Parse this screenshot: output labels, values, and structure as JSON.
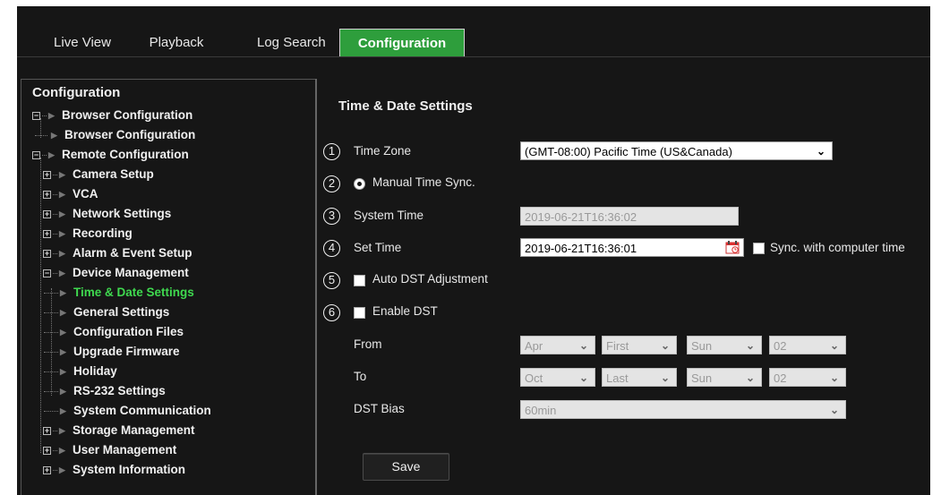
{
  "tabs": [
    {
      "label": "Live View"
    },
    {
      "label": "Playback"
    },
    {
      "label": "Log Search"
    },
    {
      "label": "Configuration"
    }
  ],
  "tree": {
    "title": "Configuration",
    "nodes": [
      {
        "label": "Browser Configuration"
      },
      {
        "label": "Browser Configuration"
      },
      {
        "label": "Remote Configuration"
      },
      {
        "label": "Camera Setup"
      },
      {
        "label": "VCA"
      },
      {
        "label": "Network Settings"
      },
      {
        "label": "Recording"
      },
      {
        "label": "Alarm & Event Setup"
      },
      {
        "label": "Device Management"
      },
      {
        "label": "Time & Date Settings"
      },
      {
        "label": "General Settings"
      },
      {
        "label": "Configuration Files"
      },
      {
        "label": "Upgrade Firmware"
      },
      {
        "label": "Holiday"
      },
      {
        "label": "RS-232 Settings"
      },
      {
        "label": "System Communication"
      },
      {
        "label": "Storage Management"
      },
      {
        "label": "User Management"
      },
      {
        "label": "System Information"
      }
    ]
  },
  "panel": {
    "title": "Time & Date Settings",
    "markers": [
      "1",
      "2",
      "3",
      "4",
      "5",
      "6"
    ],
    "time_zone_label": "Time Zone",
    "time_zone_value": "(GMT-08:00) Pacific Time (US&Canada)",
    "manual_sync_label": "Manual Time Sync.",
    "system_time_label": "System Time",
    "system_time_value": "2019-06-21T16:36:02",
    "set_time_label": "Set Time",
    "set_time_value": "2019-06-21T16:36:01",
    "sync_computer_label": "Sync. with computer time",
    "auto_dst_label": "Auto DST Adjustment",
    "enable_dst_label": "Enable DST",
    "from_label": "From",
    "from": {
      "month": "Apr",
      "week": "First",
      "day": "Sun",
      "hour": "02"
    },
    "to_label": "To",
    "to": {
      "month": "Oct",
      "week": "Last",
      "day": "Sun",
      "hour": "02"
    },
    "dst_bias_label": "DST Bias",
    "dst_bias_value": "60min",
    "save_label": "Save"
  },
  "colors": {
    "accent": "#2e9e3c",
    "active_text": "#3fd94f",
    "background": "#161616"
  }
}
